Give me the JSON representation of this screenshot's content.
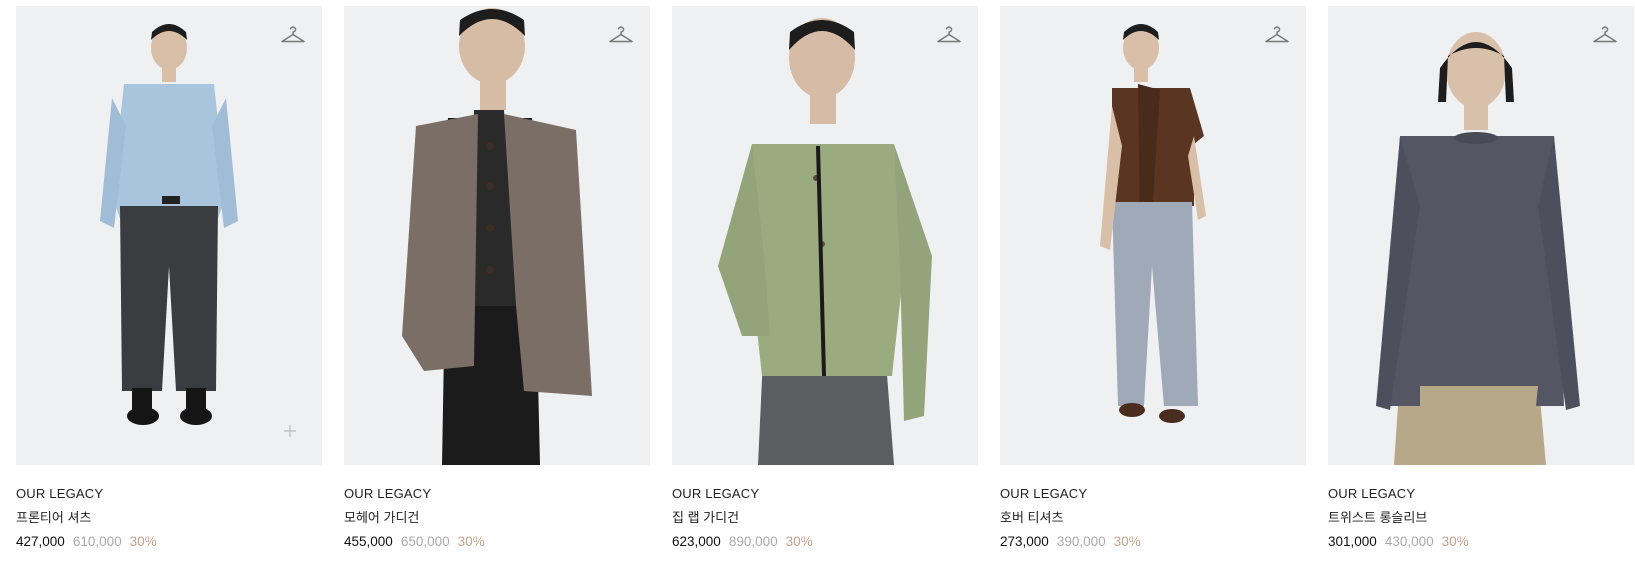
{
  "products": [
    {
      "brand": "OUR LEGACY",
      "name": "프론티어 셔츠",
      "price": "427,000",
      "original_price": "610,000",
      "discount": "30%",
      "colors": {
        "top": "#a9c4dd",
        "bottom": "#3b3c3f",
        "shoes": "#151515"
      },
      "icons": [
        "hanger-icon",
        "plus-icon"
      ]
    },
    {
      "brand": "OUR LEGACY",
      "name": "모헤어 가디건",
      "price": "455,000",
      "original_price": "650,000",
      "discount": "30%",
      "colors": {
        "top": "#7a6e66",
        "bottom": "#1b1b1b",
        "inner": "#2a2a2a"
      },
      "icons": [
        "hanger-icon"
      ]
    },
    {
      "brand": "OUR LEGACY",
      "name": "집 랩 가디건",
      "price": "623,000",
      "original_price": "890,000",
      "discount": "30%",
      "colors": {
        "top": "#9bab80",
        "bottom": "#5c5d60",
        "inner": "#151515"
      },
      "icons": [
        "hanger-icon"
      ]
    },
    {
      "brand": "OUR LEGACY",
      "name": "호버 티셔츠",
      "price": "273,000",
      "original_price": "390,000",
      "discount": "30%",
      "colors": {
        "top": "#5a3522",
        "bottom": "#9fa9b8",
        "shoes": "#4a2d1e"
      },
      "icons": [
        "hanger-icon"
      ]
    },
    {
      "brand": "OUR LEGACY",
      "name": "트위스트 롱슬리브",
      "price": "301,000",
      "original_price": "430,000",
      "discount": "30%",
      "colors": {
        "top": "#545763",
        "bottom": "#b7a889"
      },
      "icons": [
        "hanger-icon"
      ]
    }
  ]
}
